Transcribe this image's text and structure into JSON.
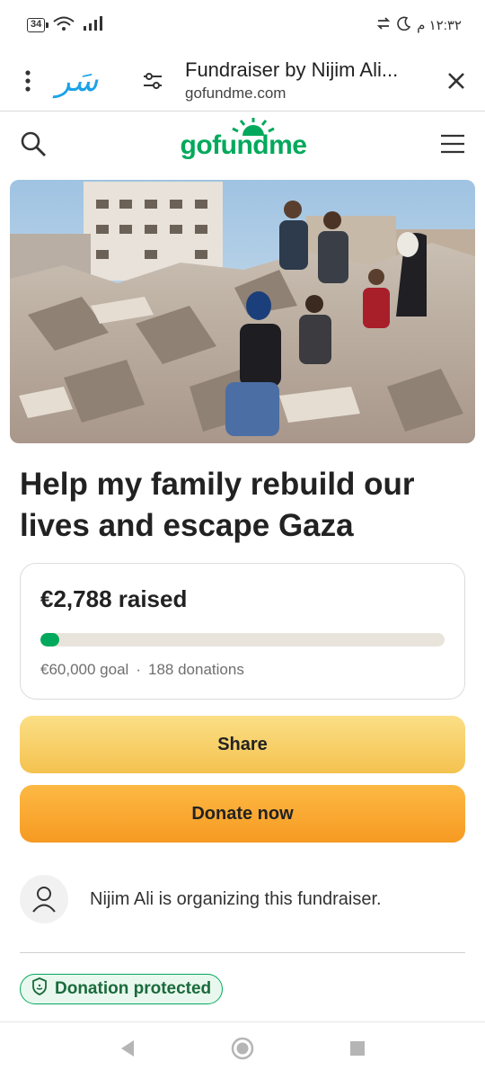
{
  "status_bar": {
    "battery": "34",
    "time": "١٢:٣٢ م"
  },
  "browser": {
    "page_title": "Fundraiser by Nijim Ali...",
    "domain": "gofundme.com",
    "site_logo_text": "سَر"
  },
  "site": {
    "logo_text": "gofundme"
  },
  "campaign": {
    "title": "Help my family rebuild our lives and escape Gaza",
    "raised": "€2,788 raised",
    "goal": "€60,000 goal",
    "separator": "·",
    "donations": "188 donations",
    "progress_fraction": 0.046
  },
  "actions": {
    "share_label": "Share",
    "donate_label": "Donate now"
  },
  "organizer": {
    "text": "Nijim Ali is organizing this fundraiser."
  },
  "badge": {
    "label": "Donation protected"
  },
  "colors": {
    "brand_green": "#02a95c",
    "share_yellow": "#f4c24f",
    "donate_orange": "#f69a22"
  }
}
